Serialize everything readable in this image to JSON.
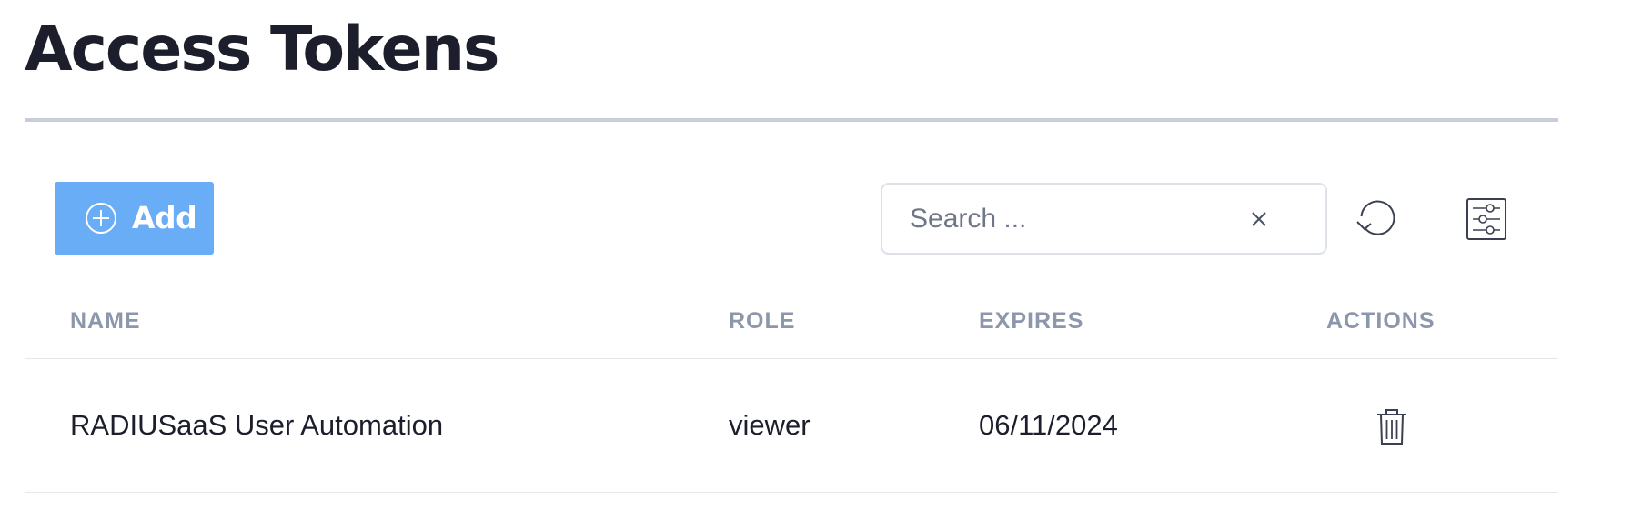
{
  "page": {
    "title": "Access Tokens"
  },
  "toolbar": {
    "add_label": "Add",
    "add_icon": "plus-circle-icon",
    "search_placeholder": "Search ...",
    "search_value": "",
    "clear_icon": "close-icon",
    "refresh_icon": "refresh-icon",
    "filter_icon": "filter-settings-icon"
  },
  "table": {
    "columns": [
      "NAME",
      "ROLE",
      "EXPIRES",
      "ACTIONS"
    ],
    "rows": [
      {
        "name": "RADIUSaaS User Automation",
        "role": "viewer",
        "expires": "06/11/2024",
        "action_icon": "trash-icon"
      }
    ]
  },
  "colors": {
    "primary_button": "#6aadf7",
    "title_text": "#1c1f2b",
    "header_text": "#8d97ab",
    "divider": "#c8ced8"
  }
}
